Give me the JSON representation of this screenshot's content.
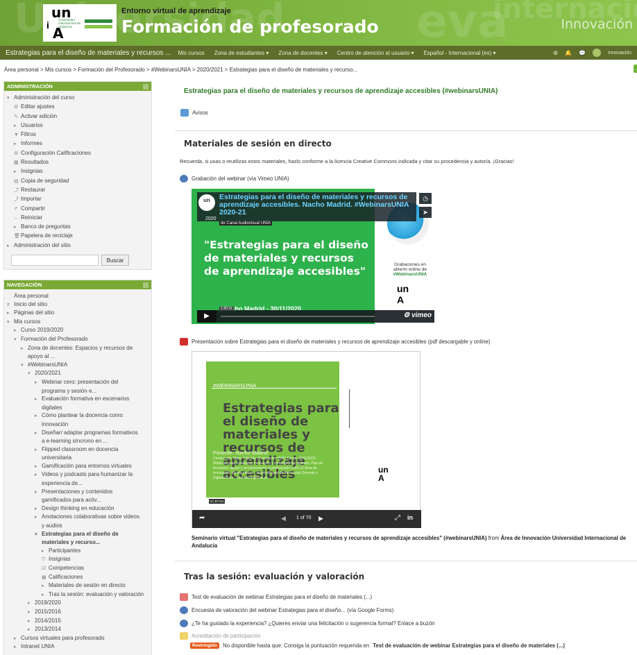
{
  "header": {
    "subtitle": "Entorno virtual de aprendizaje",
    "title": "Formación de profesorado",
    "ghost_left": "Universidad",
    "ghost_right": "eva",
    "ghost_right2": "internacional",
    "innovation": "Innovación",
    "logo": {
      "un": "un",
      "a": "A",
      "small": "Universidad Internacional de Andalucía"
    }
  },
  "navbar": {
    "site": "Estrategias para el diseño de materiales y recursos ...",
    "menu": [
      "Mis cursos",
      "Zona de estudiantes ▾",
      "Zona de docentes ▾",
      "Centro de atención al usuario ▾",
      "Español - Internacional (es) ▾"
    ],
    "user": "Innovación"
  },
  "breadcrumb": "Área personal > Mis cursos > Formación del Profesorado > #WebinarsUNIA > 2020/2021 > Estrategias para el diseño de materiales y recurso...",
  "admin": {
    "heading": "ADMINISTRACIÓN",
    "items": [
      {
        "g": "▾",
        "t": "Administración del curso",
        "i": 0
      },
      {
        "g": "⚙",
        "t": "Editar ajustes",
        "i": 1
      },
      {
        "g": "✎",
        "t": "Activar edición",
        "i": 1
      },
      {
        "g": "▸",
        "t": "Usuarios",
        "i": 1
      },
      {
        "g": "▼",
        "t": "Filtros",
        "i": 1
      },
      {
        "g": "▸",
        "t": "Informes",
        "i": 1
      },
      {
        "g": "⚙",
        "t": "Configuración Calificaciones",
        "i": 1
      },
      {
        "g": "▦",
        "t": "Resultados",
        "i": 1
      },
      {
        "g": "▸",
        "t": "Insignias",
        "i": 1
      },
      {
        "g": "▤",
        "t": "Copia de seguridad",
        "i": 1
      },
      {
        "g": "⤴",
        "t": "Restaurar",
        "i": 1
      },
      {
        "g": "⤴",
        "t": "Importar",
        "i": 1
      },
      {
        "g": "↱",
        "t": "Compartir",
        "i": 1
      },
      {
        "g": "←",
        "t": "Reiniciar",
        "i": 1
      },
      {
        "g": "▸",
        "t": "Banco de preguntas",
        "i": 1
      },
      {
        "g": "🗑",
        "t": "Papelera de reciclaje",
        "i": 1
      },
      {
        "g": "▸",
        "t": "Administración del sitio",
        "i": 0
      }
    ],
    "search_button": "Buscar"
  },
  "nav": {
    "heading": "NAVEGACIÓN",
    "items": [
      {
        "g": "",
        "t": "Área personal",
        "i": 0
      },
      {
        "g": "#",
        "t": "Inicio del sitio",
        "i": 0
      },
      {
        "g": "▸",
        "t": "Páginas del sitio",
        "i": 0
      },
      {
        "g": "▾",
        "t": "Mis cursos",
        "i": 0
      },
      {
        "g": "▸",
        "t": "Curso 2019/2020",
        "i": 1
      },
      {
        "g": "▾",
        "t": "Formación del Profesorado",
        "i": 1
      },
      {
        "g": "▸",
        "t": "Zona de docentes: Espacios y recursos de",
        "i": 2
      },
      {
        "g": "",
        "t": "apoyo al ...",
        "i": 2
      },
      {
        "g": "▾",
        "t": "#WebinarsUNIA",
        "i": 2
      },
      {
        "g": "▾",
        "t": "2020/2021",
        "i": 3
      },
      {
        "g": "▸",
        "t": "Webinar cero: presentación del",
        "i": 4
      },
      {
        "g": "",
        "t": "programa y sesión e...",
        "i": 4
      },
      {
        "g": "▸",
        "t": "Evaluación formativa en escenarios",
        "i": 4
      },
      {
        "g": "",
        "t": "digitales",
        "i": 4
      },
      {
        "g": "▸",
        "t": "Cómo plantear la docencia como",
        "i": 4
      },
      {
        "g": "",
        "t": "innovación",
        "i": 4
      },
      {
        "g": "▸",
        "t": "Diseñar/ adaptar programas formativos",
        "i": 4
      },
      {
        "g": "",
        "t": "a e-learning síncrono en ...",
        "i": 4
      },
      {
        "g": "▸",
        "t": "Flipped classroom en docencia",
        "i": 4
      },
      {
        "g": "",
        "t": "universitaria",
        "i": 4
      },
      {
        "g": "▸",
        "t": "Gamificación para entornos virtuales",
        "i": 4
      },
      {
        "g": "▸",
        "t": "Videos y podcasts para humanizar la",
        "i": 4
      },
      {
        "g": "",
        "t": "experiencia de...",
        "i": 4
      },
      {
        "g": "▸",
        "t": "Presentaciones y contenidos",
        "i": 4
      },
      {
        "g": "",
        "t": "gamificados para activ...",
        "i": 4
      },
      {
        "g": "▸",
        "t": "Design thinking en educación",
        "i": 4
      },
      {
        "g": "▸",
        "t": "Anotaciones colaborativas sobre videos",
        "i": 4
      },
      {
        "g": "",
        "t": "y audios",
        "i": 4
      },
      {
        "g": "▾",
        "t": "Estrategias para el diseño de",
        "i": 4,
        "b": 1
      },
      {
        "g": "",
        "t": "materiales y recurso...",
        "i": 4,
        "b": 1
      },
      {
        "g": "▸",
        "t": "Participantes",
        "i": 5
      },
      {
        "g": "⛉",
        "t": "Insignias",
        "i": 5
      },
      {
        "g": "☑",
        "t": "Competencias",
        "i": 5
      },
      {
        "g": "▦",
        "t": "Calificaciones",
        "i": 5
      },
      {
        "g": "▸",
        "t": "Materiales de sesión en directo",
        "i": 5
      },
      {
        "g": "▸",
        "t": "Tras la sesión: evaluación y valoración",
        "i": 5
      },
      {
        "g": "▸",
        "t": "2019/2020",
        "i": 3
      },
      {
        "g": "▸",
        "t": "2015/2016",
        "i": 3
      },
      {
        "g": "▸",
        "t": "2014/2015",
        "i": 3
      },
      {
        "g": "▸",
        "t": "2013/2014",
        "i": 3
      },
      {
        "g": "▸",
        "t": "Cursos virtuales para profesorado",
        "i": 1
      },
      {
        "g": "▸",
        "t": "Intranet UNIA",
        "i": 1
      }
    ]
  },
  "main": {
    "course_title": "Estrategias para el diseño de materiales y recursos de aprendizaje accesibles (#webinarsUNIA)",
    "avisos": "Avisos",
    "section1": "Materiales de sesión en directo",
    "notice": "Recuerda, si usas o reutilizas estos materiales, hazlo conforme a la licencia Creative Commons indicada y citar su procedencia y autoría. ¡Gracias!",
    "recording": "Grabación del webinar (vía Vimeo UNIA)",
    "video": {
      "title": "Estrategias para el diseño de materiales y recursos de aprendizaje accesibles. Nacho Madrid. #WebinarsUNIA 2020-21",
      "channel_prefix": "de",
      "channel": "Canal Audiovisual UNIA",
      "big_text": "\"Estrategias para el diseño de materiales y recursos de aprendizaje accesibles\"",
      "year": "2020",
      "grab_1": "Grabaciones en abierto online de",
      "grab_2": "#WebinarsUNIA",
      "footer": "Nacho Madrid - 30/11/2020",
      "time": "1:40:16",
      "brand": "vimeo",
      "logo": "un",
      "logo_a": "A"
    },
    "pdf": "Presentación sobre Estrategias para el diseño de materiales y recursos de aprendizaje accesibles (pdf descargable y online)",
    "slide": {
      "tag": "#WEBINARSUNIA",
      "title": "Estrategias para el diseño de materiales y recursos de aprendizaje accesibles",
      "ponente": "Ponente: Nacho Madrid",
      "info": "Conducción: María Sánchez (Innovación UNIA) Fecha: 30/11/2020 Webinars para e-learning, innovación y competencias digitales. Plan de formación, apoyo y reconocimiento al profesorado 2020-21 Área de Innovación. @unia.innova · Vicerrectorado de Innovación Docente y Digitalización · innovacion@unia.es",
      "counter": "1 of 70",
      "logo": "un",
      "logo_a": "A",
      "license": "CC BY-SA"
    },
    "caption_bold": "Seminario virtual \"Estrategias para el diseño de materiales y recursos de aprendizaje accesibles\" (#webinarsUNIA)",
    "caption_from": " from ",
    "caption_org": "Área de Innovación Universidad Internacional de Andalucía",
    "section2": "Tras la sesión: evaluación y valoración",
    "after": [
      "Test de evaluación de webinar Estrategias para el diseño de materiales (...)",
      "Encuesta de valoración del webinar Estrategias para el diseño... (vía Google Forms)",
      "¿Te ha gustado la experiencia? ¿Quieres enviar una felicitación o sugerencia formal? Enlace a buzón"
    ],
    "acred": "Acreditación de participación",
    "restricted": "Restringido",
    "restricted_text": "No disponible hasta que: Consiga la puntuación requerida en",
    "restricted_bold": "Test de evaluación de webinar Estrategias para el diseño de materiales (...)"
  },
  "colors": {
    "brand_green": "#7aaa35",
    "nav_olive": "#5e6d2a",
    "title_green": "#2f7a27",
    "restricted": "#e55b18"
  }
}
